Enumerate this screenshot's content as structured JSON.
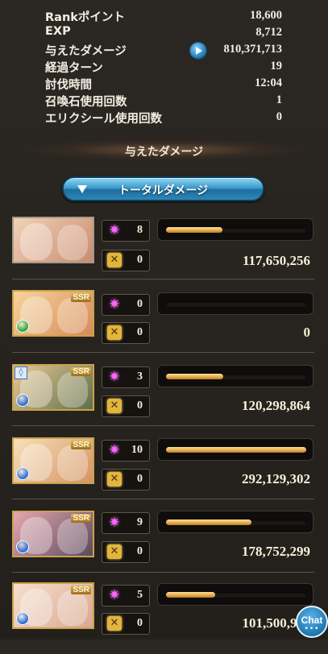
{
  "stats": [
    {
      "label": "Rankポイント",
      "value": "18,600"
    },
    {
      "label": "EXP",
      "value": "8,712"
    },
    {
      "label": "与えたダメージ",
      "value": "810,371,713"
    },
    {
      "label": "経過ターン",
      "value": "19"
    },
    {
      "label": "討伐時間",
      "value": "12:04"
    },
    {
      "label": "召喚石使用回数",
      "value": "1"
    },
    {
      "label": "エリクシール使用回数",
      "value": "0"
    }
  ],
  "section_title": "与えたダメージ",
  "damage_button_label": "トータルダメージ",
  "characters": [
    {
      "ssr": "",
      "ougi_count": "8",
      "chain_count": "0",
      "damage": "117,650,256",
      "ratio": 0.4,
      "element_color": "",
      "has_ring": false
    },
    {
      "ssr": "SSR",
      "ougi_count": "0",
      "chain_count": "0",
      "damage": "0",
      "ratio": 0.0,
      "element_color": "#2aa83a",
      "has_ring": false
    },
    {
      "ssr": "SSR",
      "ougi_count": "3",
      "chain_count": "0",
      "damage": "120,298,864",
      "ratio": 0.41,
      "element_color": "#2b6fd6",
      "has_ring": true
    },
    {
      "ssr": "SSR",
      "ougi_count": "10",
      "chain_count": "0",
      "damage": "292,129,302",
      "ratio": 1.0,
      "element_color": "#2b6fd6",
      "has_ring": false
    },
    {
      "ssr": "SSR",
      "ougi_count": "9",
      "chain_count": "0",
      "damage": "178,752,299",
      "ratio": 0.61,
      "element_color": "#2b6fd6",
      "has_ring": false
    },
    {
      "ssr": "SSR",
      "ougi_count": "5",
      "chain_count": "0",
      "damage": "101,500,99",
      "ratio": 0.35,
      "element_color": "#2b6fd6",
      "has_ring": false
    }
  ],
  "chat": {
    "label": "Chat",
    "dots": "•••"
  },
  "colors": {
    "accent": "#3c9ccd",
    "bar_fill": "#e4a947"
  }
}
